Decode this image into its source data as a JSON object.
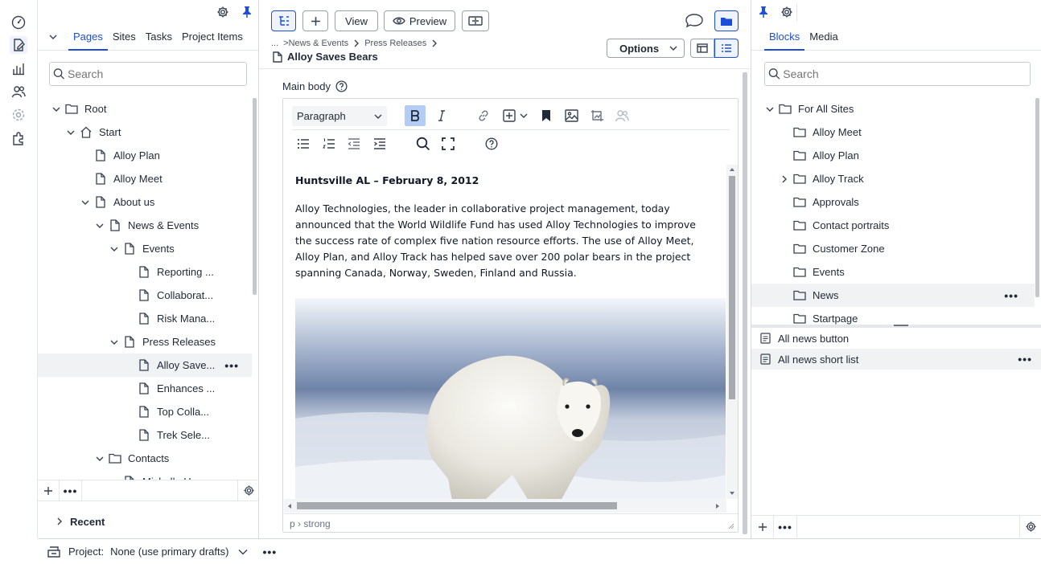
{
  "left_panel": {
    "tabs": [
      "Pages",
      "Sites",
      "Tasks",
      "Project Items"
    ],
    "search_placeholder": "Search",
    "tree": [
      {
        "label": "Root",
        "depth": 0,
        "icon": "folder-icon",
        "expanded": true
      },
      {
        "label": "Start",
        "depth": 1,
        "icon": "home-icon",
        "expanded": true
      },
      {
        "label": "Alloy Plan",
        "depth": 2,
        "icon": "page-icon"
      },
      {
        "label": "Alloy Meet",
        "depth": 2,
        "icon": "page-icon"
      },
      {
        "label": "About us",
        "depth": 2,
        "icon": "page-icon",
        "expanded": true
      },
      {
        "label": "News & Events",
        "depth": 3,
        "icon": "page-icon",
        "expanded": true
      },
      {
        "label": "Events",
        "depth": 4,
        "icon": "page-icon",
        "expanded": true
      },
      {
        "label": "Reporting ...",
        "depth": 5,
        "icon": "page-icon"
      },
      {
        "label": "Collaborat...",
        "depth": 5,
        "icon": "page-icon"
      },
      {
        "label": "Risk Mana...",
        "depth": 5,
        "icon": "page-icon"
      },
      {
        "label": "Press Releases",
        "depth": 4,
        "icon": "page-icon",
        "expanded": true
      },
      {
        "label": "Alloy Save...",
        "depth": 5,
        "icon": "page-icon",
        "selected": true
      },
      {
        "label": "Enhances ...",
        "depth": 5,
        "icon": "page-icon"
      },
      {
        "label": "Top Colla...",
        "depth": 5,
        "icon": "page-icon"
      },
      {
        "label": "Trek Sele...",
        "depth": 5,
        "icon": "page-icon"
      },
      {
        "label": "Contacts",
        "depth": 3,
        "icon": "folder-icon",
        "expanded": true
      },
      {
        "label": "Michelle Her...",
        "depth": 4,
        "icon": "page-icon"
      }
    ],
    "recent_label": "Recent"
  },
  "toolbar": {
    "view_label": "View",
    "preview_label": "Preview",
    "options_label": "Options"
  },
  "breadcrumb": {
    "ellipsis": "...",
    "items": [
      ">News & Events",
      "Press Releases"
    ],
    "title": "Alloy Saves Bears"
  },
  "editor": {
    "field_label": "Main body",
    "format_select": "Paragraph",
    "heading": "Huntsville AL – February 8, 2012",
    "body": "Alloy Technologies, the leader in collaborative project management, today announced that the World Wildlife Fund has used Alloy Technologies to improve the success rate of complex five nation resource efforts. The use of Alloy Meet, Alloy Plan, and Alloy Track has helped save over 200 polar bears in the project spanning Canada, Norway, Sweden, Finland and Russia.",
    "status_path": "p › strong"
  },
  "right_panel": {
    "tabs": [
      "Blocks",
      "Media"
    ],
    "search_placeholder": "Search",
    "folders": [
      {
        "label": "For All Sites",
        "depth": 0,
        "expanded": true
      },
      {
        "label": "Alloy Meet",
        "depth": 1
      },
      {
        "label": "Alloy Plan",
        "depth": 1
      },
      {
        "label": "Alloy Track",
        "depth": 1,
        "collapsed": true
      },
      {
        "label": "Approvals",
        "depth": 1
      },
      {
        "label": "Contact portraits",
        "depth": 1
      },
      {
        "label": "Customer Zone",
        "depth": 1
      },
      {
        "label": "Events",
        "depth": 1
      },
      {
        "label": "News",
        "depth": 1,
        "selected": true
      },
      {
        "label": "Startpage",
        "depth": 1
      }
    ],
    "blocks": [
      {
        "label": "All news button"
      },
      {
        "label": "All news short list",
        "selected": true
      }
    ]
  },
  "bottom_bar": {
    "project_label": "Project:",
    "project_value": "None (use primary drafts)"
  },
  "colors": {
    "accent": "#1d4ed8",
    "selected_row": "#f1f2f4",
    "border": "#d6d9de"
  }
}
